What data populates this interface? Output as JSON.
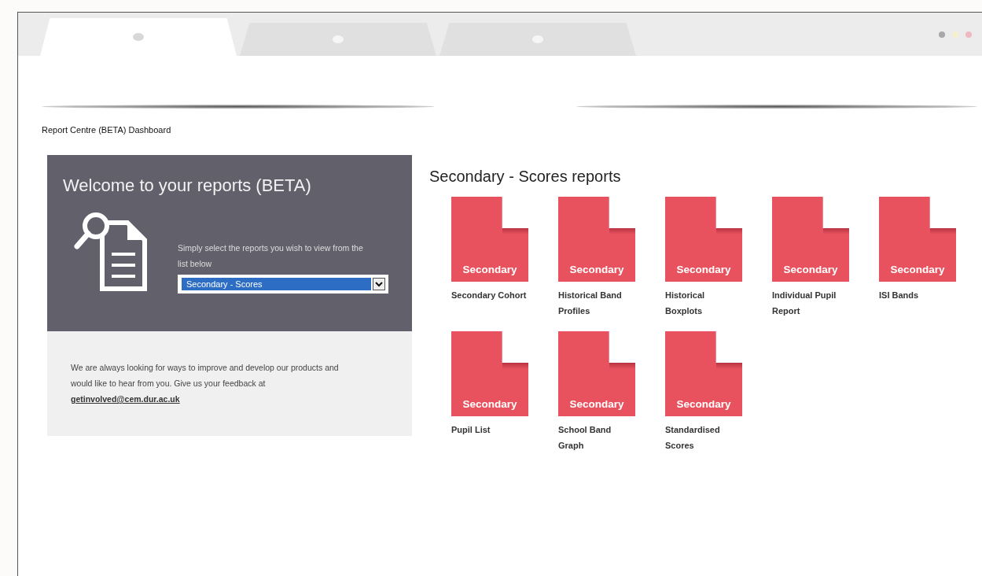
{
  "browser": {
    "tabs": [
      {
        "selected": true
      },
      {
        "selected": false
      },
      {
        "selected": false
      }
    ]
  },
  "breadcrumb": "Report Centre (BETA) Dashboard",
  "welcome": {
    "title": "Welcome to your reports (BETA)",
    "instruction": "Simply select the reports you wish to view from the list below",
    "select": {
      "value": "Secondary - Scores"
    }
  },
  "feedback": {
    "text": "We are always looking for ways to improve and develop our products and would like to hear from you. Give us your feedback at ",
    "email": "getinvolved@cem.dur.ac.uk"
  },
  "section_title": "Secondary - Scores reports",
  "reports": [
    {
      "badge": "Secondary",
      "name": "Secondary Cohort"
    },
    {
      "badge": "Secondary",
      "name": "Historical Band Profiles"
    },
    {
      "badge": "Secondary",
      "name": "Historical Boxplots"
    },
    {
      "badge": "Secondary",
      "name": "Individual Pupil Report"
    },
    {
      "badge": "Secondary",
      "name": "ISI Bands"
    },
    {
      "badge": "Secondary",
      "name": "Pupil List"
    },
    {
      "badge": "Secondary",
      "name": "School Band Graph"
    },
    {
      "badge": "Secondary",
      "name": "Standardised Scores"
    }
  ]
}
